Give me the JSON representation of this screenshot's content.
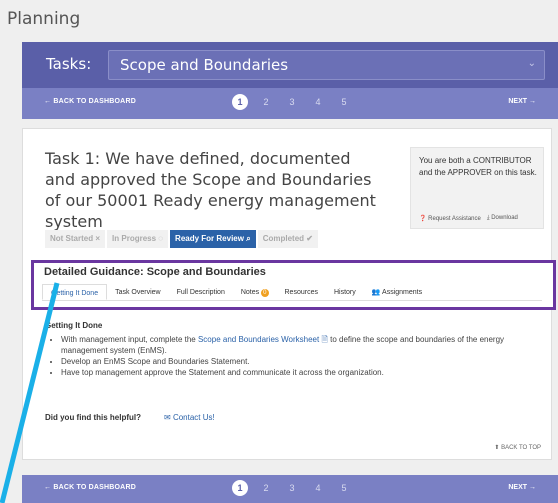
{
  "page": {
    "title": "Planning"
  },
  "tasks": {
    "label": "Tasks:",
    "selected": "Scope and Boundaries"
  },
  "nav": {
    "back": "← BACK TO DASHBOARD",
    "pages": [
      "1",
      "2",
      "3",
      "4",
      "5"
    ],
    "active_page": "1",
    "next": "NEXT →"
  },
  "task": {
    "heading": "Task 1: We have defined, documented and approved the Scope and Boundaries of our 50001 Ready energy management system",
    "role_text": "You are both a CONTRIBUTOR and the APPROVER on this task.",
    "request_assistance": "Request Assistance",
    "download": "Download"
  },
  "statuses": [
    {
      "label": "Not Started",
      "icon": "×",
      "active": false
    },
    {
      "label": "In Progress",
      "icon": "◌",
      "active": false
    },
    {
      "label": "Ready For Review",
      "icon": "⌕",
      "active": true
    },
    {
      "label": "Completed",
      "icon": "✔",
      "active": false
    }
  ],
  "guidance": {
    "title": "Detailed Guidance: Scope and Boundaries",
    "tabs": [
      "Getting It Done",
      "Task Overview",
      "Full Description",
      "Notes",
      "Resources",
      "History",
      "Assignments"
    ],
    "notes_count": "0"
  },
  "getting_it_done": {
    "heading": "Getting It Done",
    "steps": [
      {
        "pre": "With management input, complete the ",
        "link": "Scope and Boundaries Worksheet",
        "post": " to define the scope and boundaries of the energy management system (EnMS)."
      },
      {
        "text": "Develop an EnMS Scope and Boundaries Statement."
      },
      {
        "text": "Have top management approve the Statement and communicate it across the organization."
      }
    ]
  },
  "feedback": {
    "question": "Did you find this helpful?",
    "contact": "Contact Us!"
  },
  "back_to_top": "BACK TO TOP",
  "colors": {
    "primary": "#5a5fa8",
    "navbar": "#7a80c4",
    "accent_blue": "#2b62a8",
    "highlight": "#6a36a0",
    "pointer": "#1ab0e8"
  },
  "icons": [
    "chevron-down-icon",
    "question-circle-icon",
    "download-icon",
    "envelope-icon",
    "arrow-up-circle-icon",
    "users-icon",
    "document-icon"
  ]
}
